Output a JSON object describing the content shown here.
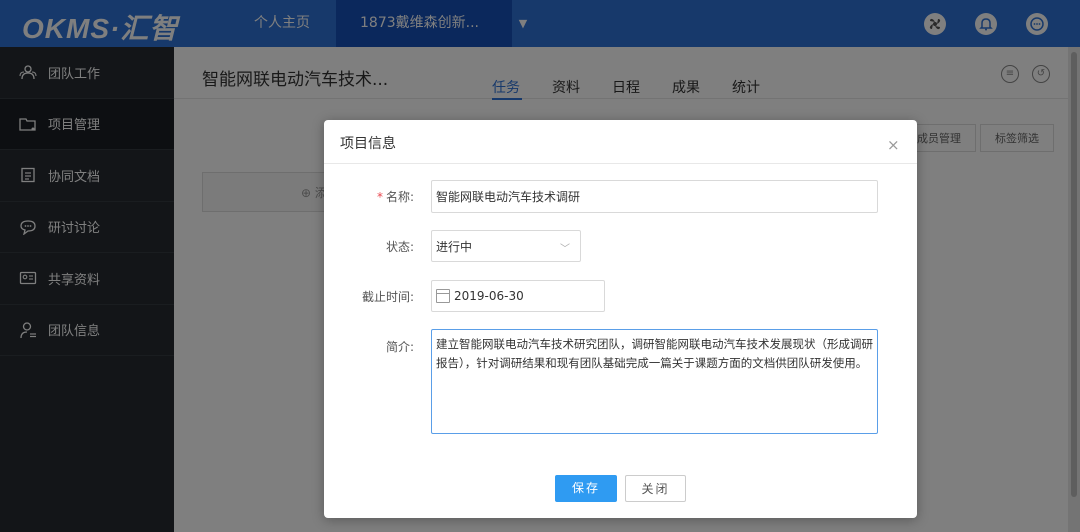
{
  "topbar": {
    "logo": "OKMS·汇智",
    "nav_home": "个人主页",
    "nav_team": "1873戴维森创新...",
    "caret": "▼",
    "icons": [
      "fan-icon",
      "bell-icon",
      "chat-icon"
    ]
  },
  "sidebar": {
    "items": [
      {
        "label": "团队工作",
        "icon": "team-work-icon"
      },
      {
        "label": "项目管理",
        "icon": "project-folder-icon"
      },
      {
        "label": "协同文档",
        "icon": "document-icon"
      },
      {
        "label": "研讨讨论",
        "icon": "discussion-icon"
      },
      {
        "label": "共享资料",
        "icon": "shared-files-icon"
      },
      {
        "label": "团队信息",
        "icon": "team-info-icon"
      }
    ]
  },
  "content": {
    "project_title": "智能网联电动汽车技术...",
    "tabs": [
      "任务",
      "资料",
      "日程",
      "成果",
      "统计"
    ],
    "active_tab": "任务",
    "toolbar": {
      "member_manage": "成员管理",
      "tag_filter": "标签筛选"
    },
    "task_card_text": "⊕ 添"
  },
  "modal": {
    "title": "项目信息",
    "close": "×",
    "name_label": "名称:",
    "name_required": "*",
    "name_value": "智能网联电动汽车技术调研",
    "status_label": "状态:",
    "status_value": "进行中",
    "deadline_label": "截止时间:",
    "deadline_value": "2019-06-30",
    "intro_label": "简介:",
    "intro_value": "建立智能网联电动汽车技术研究团队，调研智能网联电动汽车技术发展现状（形成调研报告），针对调研结果和现有团队基础完成一篇关于课题方面的文档供团队研发使用。",
    "save_button": "保存",
    "close_button": "关闭"
  },
  "colors": {
    "topbar": "#2e72d6",
    "topbar_active": "#1750b8",
    "sidebar": "#262b31",
    "primary_button": "#2f9bf2",
    "required": "#e9474f"
  }
}
